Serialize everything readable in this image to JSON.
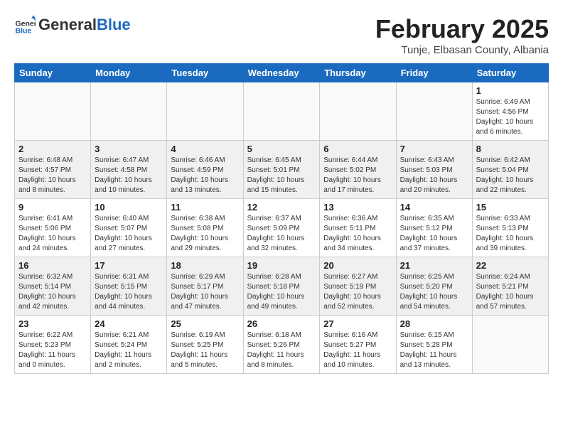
{
  "logo": {
    "general": "General",
    "blue": "Blue"
  },
  "header": {
    "month": "February 2025",
    "location": "Tunje, Elbasan County, Albania"
  },
  "weekdays": [
    "Sunday",
    "Monday",
    "Tuesday",
    "Wednesday",
    "Thursday",
    "Friday",
    "Saturday"
  ],
  "weeks": [
    [
      {
        "day": "",
        "info": ""
      },
      {
        "day": "",
        "info": ""
      },
      {
        "day": "",
        "info": ""
      },
      {
        "day": "",
        "info": ""
      },
      {
        "day": "",
        "info": ""
      },
      {
        "day": "",
        "info": ""
      },
      {
        "day": "1",
        "info": "Sunrise: 6:49 AM\nSunset: 4:56 PM\nDaylight: 10 hours and 6 minutes."
      }
    ],
    [
      {
        "day": "2",
        "info": "Sunrise: 6:48 AM\nSunset: 4:57 PM\nDaylight: 10 hours and 8 minutes."
      },
      {
        "day": "3",
        "info": "Sunrise: 6:47 AM\nSunset: 4:58 PM\nDaylight: 10 hours and 10 minutes."
      },
      {
        "day": "4",
        "info": "Sunrise: 6:46 AM\nSunset: 4:59 PM\nDaylight: 10 hours and 13 minutes."
      },
      {
        "day": "5",
        "info": "Sunrise: 6:45 AM\nSunset: 5:01 PM\nDaylight: 10 hours and 15 minutes."
      },
      {
        "day": "6",
        "info": "Sunrise: 6:44 AM\nSunset: 5:02 PM\nDaylight: 10 hours and 17 minutes."
      },
      {
        "day": "7",
        "info": "Sunrise: 6:43 AM\nSunset: 5:03 PM\nDaylight: 10 hours and 20 minutes."
      },
      {
        "day": "8",
        "info": "Sunrise: 6:42 AM\nSunset: 5:04 PM\nDaylight: 10 hours and 22 minutes."
      }
    ],
    [
      {
        "day": "9",
        "info": "Sunrise: 6:41 AM\nSunset: 5:06 PM\nDaylight: 10 hours and 24 minutes."
      },
      {
        "day": "10",
        "info": "Sunrise: 6:40 AM\nSunset: 5:07 PM\nDaylight: 10 hours and 27 minutes."
      },
      {
        "day": "11",
        "info": "Sunrise: 6:38 AM\nSunset: 5:08 PM\nDaylight: 10 hours and 29 minutes."
      },
      {
        "day": "12",
        "info": "Sunrise: 6:37 AM\nSunset: 5:09 PM\nDaylight: 10 hours and 32 minutes."
      },
      {
        "day": "13",
        "info": "Sunrise: 6:36 AM\nSunset: 5:11 PM\nDaylight: 10 hours and 34 minutes."
      },
      {
        "day": "14",
        "info": "Sunrise: 6:35 AM\nSunset: 5:12 PM\nDaylight: 10 hours and 37 minutes."
      },
      {
        "day": "15",
        "info": "Sunrise: 6:33 AM\nSunset: 5:13 PM\nDaylight: 10 hours and 39 minutes."
      }
    ],
    [
      {
        "day": "16",
        "info": "Sunrise: 6:32 AM\nSunset: 5:14 PM\nDaylight: 10 hours and 42 minutes."
      },
      {
        "day": "17",
        "info": "Sunrise: 6:31 AM\nSunset: 5:15 PM\nDaylight: 10 hours and 44 minutes."
      },
      {
        "day": "18",
        "info": "Sunrise: 6:29 AM\nSunset: 5:17 PM\nDaylight: 10 hours and 47 minutes."
      },
      {
        "day": "19",
        "info": "Sunrise: 6:28 AM\nSunset: 5:18 PM\nDaylight: 10 hours and 49 minutes."
      },
      {
        "day": "20",
        "info": "Sunrise: 6:27 AM\nSunset: 5:19 PM\nDaylight: 10 hours and 52 minutes."
      },
      {
        "day": "21",
        "info": "Sunrise: 6:25 AM\nSunset: 5:20 PM\nDaylight: 10 hours and 54 minutes."
      },
      {
        "day": "22",
        "info": "Sunrise: 6:24 AM\nSunset: 5:21 PM\nDaylight: 10 hours and 57 minutes."
      }
    ],
    [
      {
        "day": "23",
        "info": "Sunrise: 6:22 AM\nSunset: 5:23 PM\nDaylight: 11 hours and 0 minutes."
      },
      {
        "day": "24",
        "info": "Sunrise: 6:21 AM\nSunset: 5:24 PM\nDaylight: 11 hours and 2 minutes."
      },
      {
        "day": "25",
        "info": "Sunrise: 6:19 AM\nSunset: 5:25 PM\nDaylight: 11 hours and 5 minutes."
      },
      {
        "day": "26",
        "info": "Sunrise: 6:18 AM\nSunset: 5:26 PM\nDaylight: 11 hours and 8 minutes."
      },
      {
        "day": "27",
        "info": "Sunrise: 6:16 AM\nSunset: 5:27 PM\nDaylight: 11 hours and 10 minutes."
      },
      {
        "day": "28",
        "info": "Sunrise: 6:15 AM\nSunset: 5:28 PM\nDaylight: 11 hours and 13 minutes."
      },
      {
        "day": "",
        "info": ""
      }
    ]
  ]
}
